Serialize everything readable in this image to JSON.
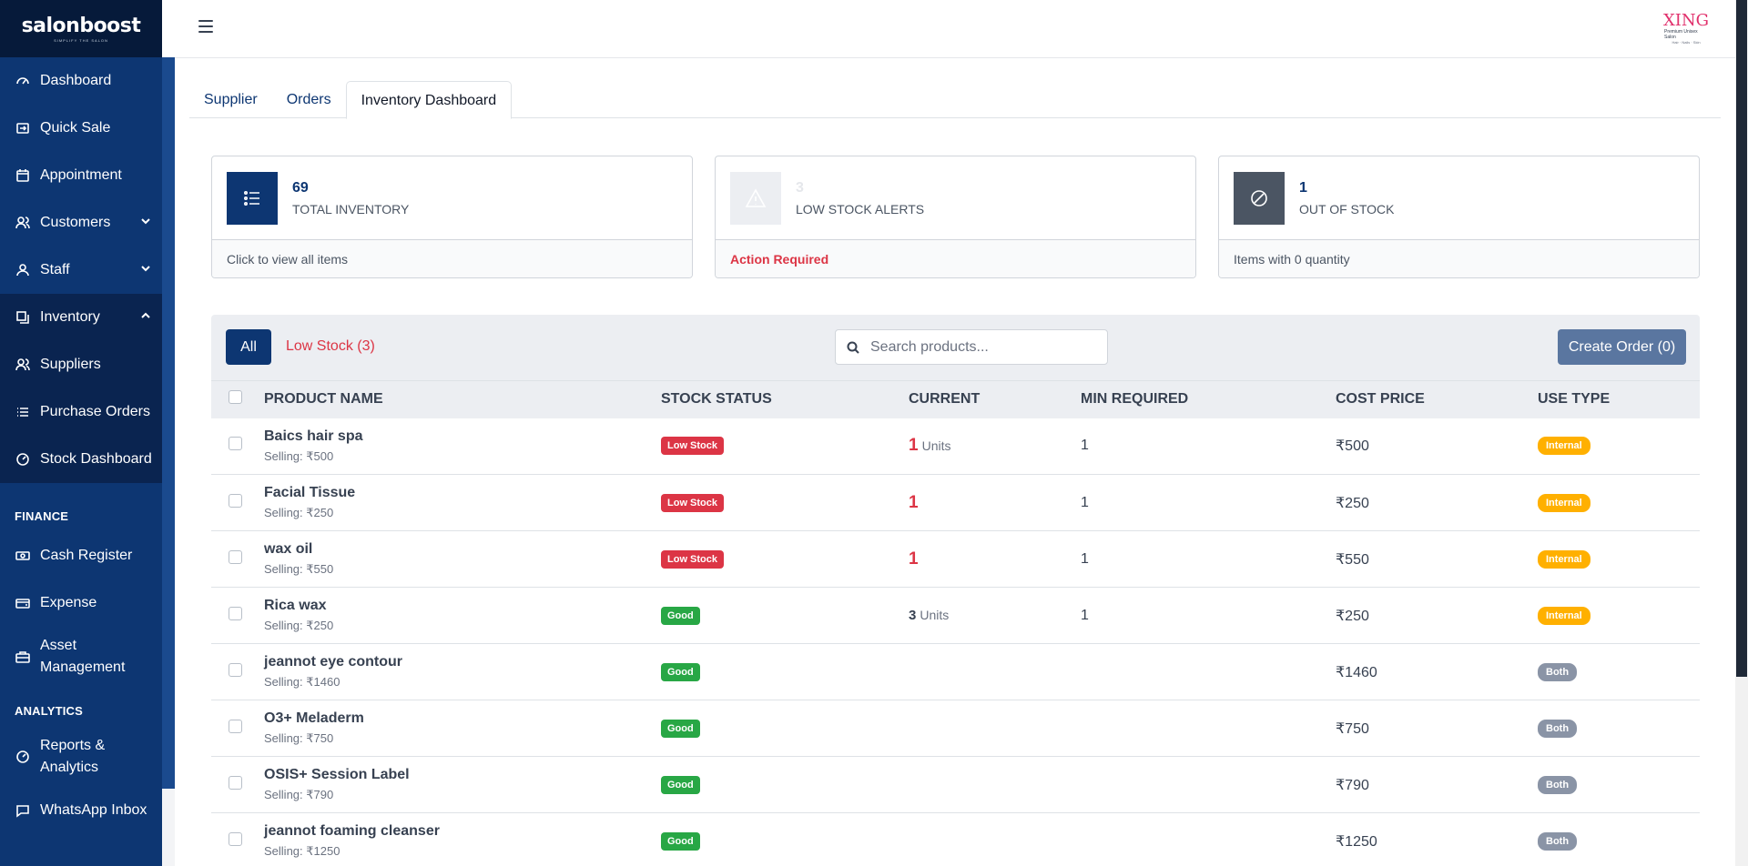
{
  "brand": {
    "name": "salonboost",
    "tagline": "SIMPLIFY THE SALON"
  },
  "header": {
    "logo_text": "XING",
    "logo_sub1": "Premium Unisex Salon",
    "logo_sub2": "Hair · Nails · Skin"
  },
  "sidebar": {
    "items": [
      {
        "label": "Dashboard",
        "icon": "gauge-icon"
      },
      {
        "label": "Quick Sale",
        "icon": "login-icon"
      },
      {
        "label": "Appointment",
        "icon": "calendar-icon"
      },
      {
        "label": "Customers",
        "icon": "users-icon"
      },
      {
        "label": "Staff",
        "icon": "user-icon"
      },
      {
        "label": "Inventory",
        "icon": "boxes-icon"
      },
      {
        "label": "Suppliers",
        "icon": "users-icon"
      },
      {
        "label": "Purchase Orders",
        "icon": "list-icon"
      },
      {
        "label": "Stock Dashboard",
        "icon": "clock-icon"
      }
    ],
    "finance_label": "FINANCE",
    "finance_items": [
      {
        "label": "Cash Register",
        "icon": "cash-icon"
      },
      {
        "label": "Expense",
        "icon": "wallet-icon"
      },
      {
        "label": "Asset Management",
        "icon": "briefcase-icon"
      }
    ],
    "analytics_label": "ANALYTICS",
    "analytics_items": [
      {
        "label": "Reports & Analytics",
        "icon": "chart-icon"
      },
      {
        "label": "WhatsApp Inbox",
        "icon": "chat-icon"
      }
    ]
  },
  "tabs": [
    "Supplier",
    "Orders",
    "Inventory Dashboard"
  ],
  "cards": [
    {
      "value": "69",
      "label": "TOTAL INVENTORY",
      "footer": "Click to view all items",
      "color": "#0d3672"
    },
    {
      "value": "3",
      "label": "LOW STOCK ALERTS",
      "footer": "Action Required",
      "color": "#e5e7eb"
    },
    {
      "value": "1",
      "label": "OUT OF STOCK",
      "footer": "Items with 0 quantity",
      "color": "#4b5563"
    }
  ],
  "filters": {
    "all_label": "All",
    "low_label": "Low Stock (3)",
    "search_placeholder": "Search products...",
    "create_label": "Create Order (0)"
  },
  "table": {
    "columns": [
      "PRODUCT NAME",
      "STOCK STATUS",
      "CURRENT",
      "MIN REQUIRED",
      "COST PRICE",
      "USE TYPE"
    ],
    "rows": [
      {
        "name": "Baics hair spa",
        "selling": "Selling: ₹500",
        "status": "Low Stock",
        "current": "1",
        "units": "Units",
        "min": "1",
        "cost": "₹500",
        "use": "Internal"
      },
      {
        "name": "Facial Tissue",
        "selling": "Selling: ₹250",
        "status": "Low Stock",
        "current": "1",
        "units": "",
        "min": "1",
        "cost": "₹250",
        "use": "Internal"
      },
      {
        "name": "wax oil",
        "selling": "Selling: ₹550",
        "status": "Low Stock",
        "current": "1",
        "units": "",
        "min": "1",
        "cost": "₹550",
        "use": "Internal"
      },
      {
        "name": "Rica wax",
        "selling": "Selling: ₹250",
        "status": "Good",
        "current": "3",
        "units": "Units",
        "min": "1",
        "cost": "₹250",
        "use": "Internal"
      },
      {
        "name": "jeannot eye contour",
        "selling": "Selling: ₹1460",
        "status": "Good",
        "current": "",
        "units": "",
        "min": "",
        "cost": "₹1460",
        "use": "Both"
      },
      {
        "name": "O3+ Meladerm",
        "selling": "Selling: ₹750",
        "status": "Good",
        "current": "",
        "units": "",
        "min": "",
        "cost": "₹750",
        "use": "Both"
      },
      {
        "name": "OSIS+ Session Label",
        "selling": "Selling: ₹790",
        "status": "Good",
        "current": "",
        "units": "",
        "min": "",
        "cost": "₹790",
        "use": "Both"
      },
      {
        "name": "jeannot foaming cleanser",
        "selling": "Selling: ₹1250",
        "status": "Good",
        "current": "",
        "units": "",
        "min": "",
        "cost": "₹1250",
        "use": "Both"
      }
    ]
  }
}
